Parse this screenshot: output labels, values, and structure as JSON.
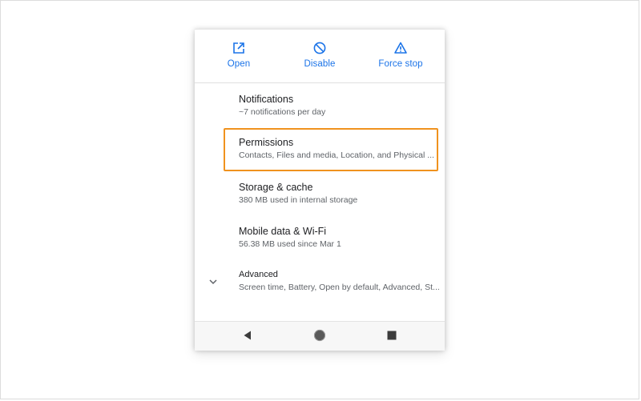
{
  "action_bar": {
    "open": {
      "label": "Open",
      "icon": "open-in-new-icon"
    },
    "disable": {
      "label": "Disable",
      "icon": "block-icon"
    },
    "force_stop": {
      "label": "Force stop",
      "icon": "warning-icon"
    },
    "accent_color": "#1a73e8"
  },
  "settings": [
    {
      "title": "Notifications",
      "subtitle": "~7 notifications per day"
    },
    {
      "title": "Permissions",
      "subtitle": "Contacts, Files and media, Location, and Physical ..."
    },
    {
      "title": "Storage & cache",
      "subtitle": "380 MB used in internal storage"
    },
    {
      "title": "Mobile data & Wi-Fi",
      "subtitle": "56.38 MB used since Mar 1"
    },
    {
      "title": "Advanced",
      "subtitle": "Screen time, Battery, Open by default, Advanced, St..."
    }
  ],
  "highlight": {
    "target": "Permissions",
    "color": "#f0921e"
  },
  "navigation": {
    "back": "back-triangle-icon",
    "home": "home-circle-icon",
    "recents": "recents-square-icon"
  }
}
